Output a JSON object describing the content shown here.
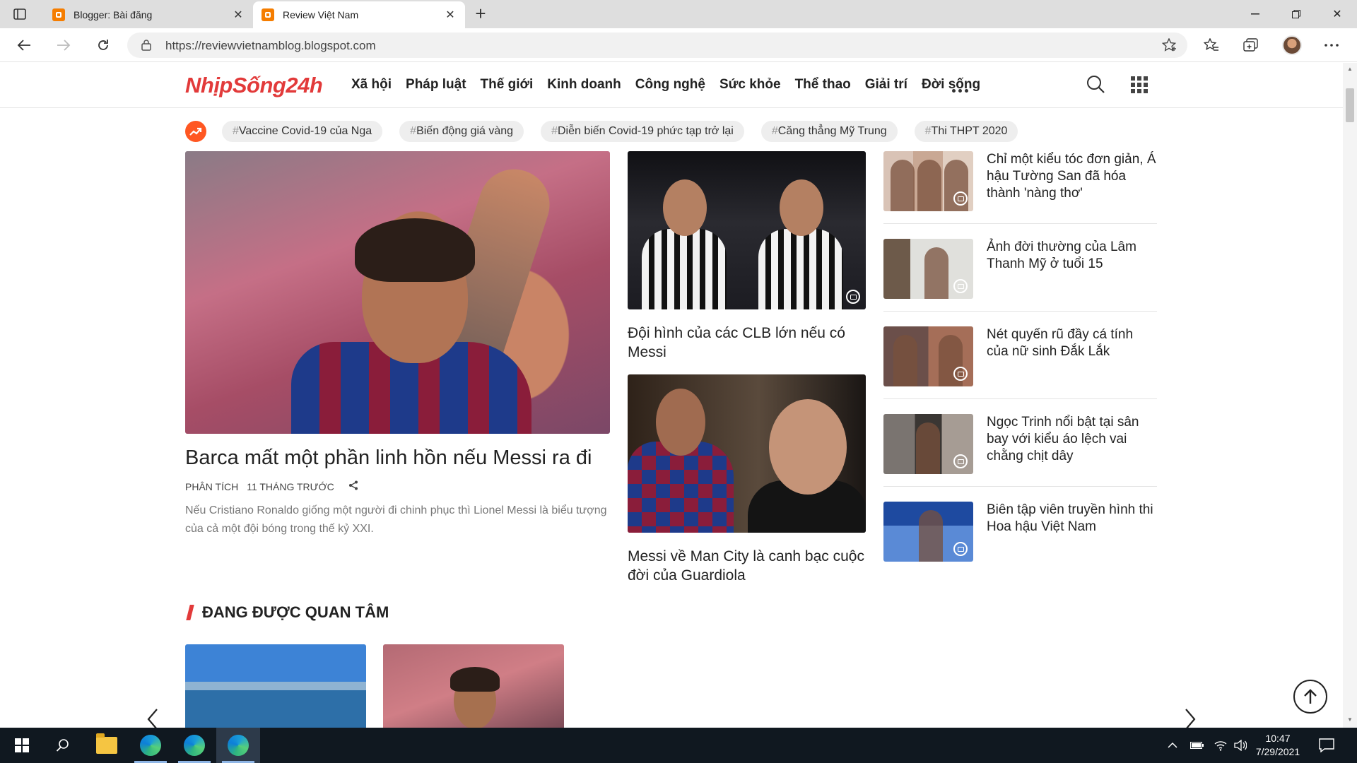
{
  "browser": {
    "tabs": [
      {
        "title": "Blogger: Bài đăng",
        "active": false
      },
      {
        "title": "Review Việt Nam",
        "active": true
      }
    ],
    "url": "https://reviewvietnamblog.blogspot.com"
  },
  "site": {
    "logo": "NhịpSống24h",
    "menu": [
      "Xã hội",
      "Pháp luật",
      "Thế giới",
      "Kinh doanh",
      "Công nghệ",
      "Sức khỏe",
      "Thể thao",
      "Giải trí",
      "Đời sống"
    ]
  },
  "trending": {
    "tags": [
      "Vaccine Covid-19 của Nga",
      "Biến động giá vàng",
      "Diễn biến Covid-19 phức tạp trở lại",
      "Căng thẳng Mỹ Trung",
      "Thi THPT 2020"
    ]
  },
  "featured": {
    "title": "Barca mất một phần linh hồn nếu Messi ra đi",
    "category": "PHÂN TÍCH",
    "time": "11 THÁNG TRƯỚC",
    "description": "Nếu Cristiano Ronaldo giống một người đi chinh phục thì Lionel Messi là biểu tượng của cả một đội bóng trong thế kỷ XXI."
  },
  "middle": [
    {
      "title": "Đội hình của các CLB lớn nếu có Messi"
    },
    {
      "title": "Messi về Man City là canh bạc cuộc đời của Guardiola"
    }
  ],
  "side": [
    {
      "title": "Chỉ một kiểu tóc đơn giản, Á hậu Tường San đã hóa thành 'nàng thơ'"
    },
    {
      "title": "Ảnh đời thường của Lâm Thanh Mỹ ở tuổi 15"
    },
    {
      "title": "Nét quyến rũ đầy cá tính của nữ sinh Đắk Lắk"
    },
    {
      "title": "Ngọc Trinh nổi bật tại sân bay với kiểu áo lệch vai chằng chịt dây"
    },
    {
      "title": "Biên tập viên truyền hình thi Hoa hậu Việt Nam"
    }
  ],
  "section": {
    "title": "ĐANG ĐƯỢC QUAN TÂM"
  },
  "taskbar": {
    "time": "10:47",
    "date": "7/29/2021"
  },
  "colors": {
    "brand": "#e23a3a",
    "trend_icon": "#ff5722",
    "taskbar": "#101820"
  }
}
